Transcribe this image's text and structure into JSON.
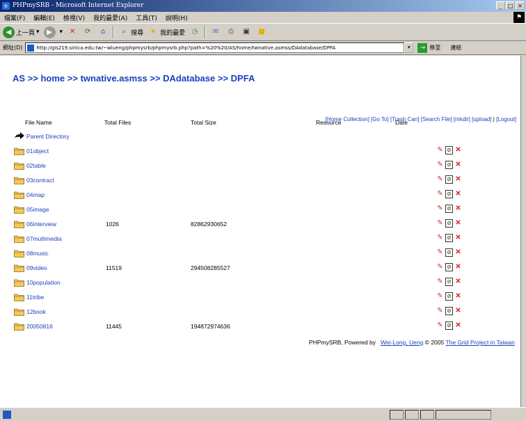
{
  "window": {
    "title": "PHPmySRB - Microsoft Internet Explorer",
    "controls": [
      "_",
      "□",
      "×"
    ]
  },
  "menu": [
    "檔案(F)",
    "編輯(E)",
    "檢視(V)",
    "我的最愛(A)",
    "工具(T)",
    "說明(H)"
  ],
  "toolbar": {
    "back_label": "上一頁",
    "search_label": "搜尋",
    "favorites_label": "我的最愛"
  },
  "address": {
    "label": "網址(D)",
    "url": "http://gis219.sinica.edu.tw/~wlueng/phpmysrb/phpmysrb.php?path=%20%20/AS/home/twnative.asmss/DAdatabase/DPFA",
    "go_label": "移至",
    "links_label": "連結"
  },
  "breadcrumb": [
    {
      "label": "AS",
      "sep": " >> "
    },
    {
      "label": "home",
      "sep": " >> "
    },
    {
      "label": "twnative.asmss",
      "sep": " >> "
    },
    {
      "label": "DAdatabase",
      "sep": " >> "
    },
    {
      "label": "DPFA",
      "sep": ""
    }
  ],
  "actions": [
    "[Home Collection]",
    "[Go To]",
    "[Trash Can]",
    "[Search File]",
    "[mkdir]",
    "[upload]",
    "|",
    "[Logout]"
  ],
  "columns": {
    "file_name": "File Name",
    "total_files": "Total Files",
    "total_size": "Total Size",
    "resource": "Resource",
    "date": "Date"
  },
  "parent": "Parent Directory",
  "rows": [
    {
      "name": "01object",
      "files": "",
      "size": ""
    },
    {
      "name": "02table",
      "files": "",
      "size": ""
    },
    {
      "name": "03contract",
      "files": "",
      "size": ""
    },
    {
      "name": "04map",
      "files": "",
      "size": ""
    },
    {
      "name": "05image",
      "files": "",
      "size": ""
    },
    {
      "name": "06interview",
      "files": "1026",
      "size": "82862930652"
    },
    {
      "name": "07multimedia",
      "files": "",
      "size": ""
    },
    {
      "name": "08music",
      "files": "",
      "size": ""
    },
    {
      "name": "09video",
      "files": "11519",
      "size": "294508285527"
    },
    {
      "name": "10population",
      "files": "",
      "size": ""
    },
    {
      "name": "11tribe",
      "files": "",
      "size": ""
    },
    {
      "name": "12book",
      "files": "",
      "size": ""
    },
    {
      "name": "20050816",
      "files": "11445",
      "size": "194872974636"
    }
  ],
  "footer": {
    "powered_by": "PHPmySRB, Powered by",
    "author": "Wei-Long, Ueng",
    "copyright": "© 2005",
    "project": "The Grid Project in Taiwan"
  },
  "colors": {
    "link": "#1b3fbf",
    "folder": "#e8b84a",
    "edit": "#c0392b",
    "delete": "#d81b1b"
  }
}
